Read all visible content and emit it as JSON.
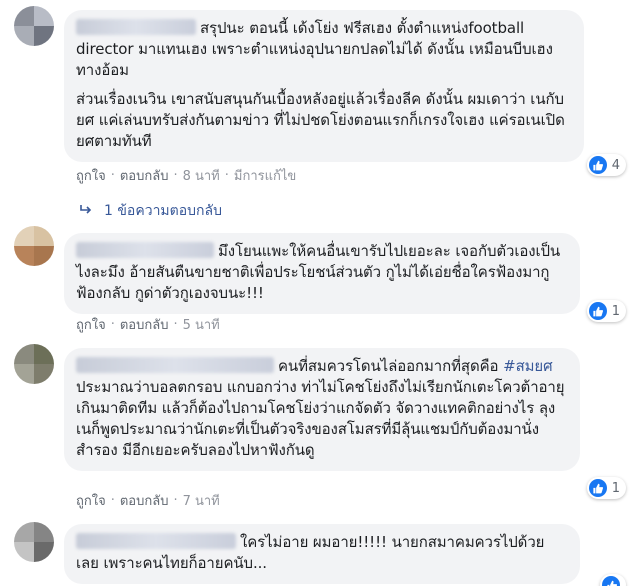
{
  "comments": [
    {
      "paragraphs": [
        "สรุปนะ ตอนนี้ เด้งโย่ง ฟรีสเฮง ตั้งตำแหน่งfootball director มาแทนเฮง เพราะตำแหน่งอุปนายกปลดไม่ได้ ดังนั้น เหมือนบีบเฮงทางอ้อม",
        "ส่วนเรื่องเนวิน เขาสนับสนุนกันเบื้องหลังอยู่แล้วเรื่องลีค ดังนั้น ผมเดาว่า เนกับยศ แค่เล่นบทรับส่งกันตามข่าว ที่ไม่ปชดโย่งตอนแรกก็เกรงใจเฮง แค่รอเนเปิด ยศตามทันที"
      ],
      "like": "ถูกใจ",
      "reply": "ตอบกลับ",
      "time": "8 นาที",
      "edited": "มีการแก้ไข",
      "reactions": "4"
    },
    {
      "text": "มึงโยนแพะให้คนอื่นเขารับไปเยอะละ เจอกับตัวเองเป็นไงละมึง อ้ายสันตืนขายชาติเพื่อประโยชน์ส่วนตัว กูไม่ได้เอ่ยชื่อใครฟ้องมากูฟ้องกลับ กูด่าตัวกูเองจบนะ!!!",
      "like": "ถูกใจ",
      "reply": "ตอบกลับ",
      "time": "5 นาที",
      "reactions": "1"
    },
    {
      "text_a": "คนที่สมควรโดนไล่ออกมากที่สุดคือ",
      "hashtag": "#สมยศ",
      "text_b": " ประมาณว่าบอลตกรอบ แกบอกว่าง ท่าไม่โคชโย่งถึงไม่เรียกนักเตะโควต้าอายุเกินมาติดทีม แล้วก็ต้องไปถามโคชโย่งว่าแกจัดตัว จัดวางแทคติกอย่างไร ลุงเนก็พูดประมาณว่านักเตะที่เป็นตัวจริงของสโมสรที่มีลุ้นแชมป์กับต้องมานั่งสำรอง มีอีกเยอะครับลองไปหาฟังกันดู",
      "like": "ถูกใจ",
      "reply": "ตอบกลับ",
      "time": "7 นาที",
      "reactions": "1"
    },
    {
      "text": "ใครไม่อาย ผมอาย!!!!! นายกสมาคมควรไปด้วยเลย เพราะคนไทยก็อายคนับ..."
    }
  ],
  "replies_link": "1 ข้อความตอบกลับ",
  "colors": {
    "bubble": "#f2f3f5",
    "link": "#385898",
    "like": "#1877f2",
    "meta": "#606770"
  }
}
